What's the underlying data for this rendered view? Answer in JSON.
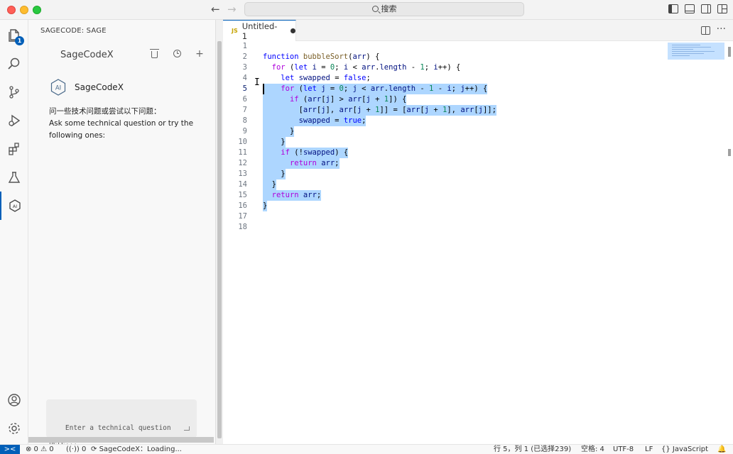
{
  "titlebar": {
    "search_label": "搜索"
  },
  "activity": {
    "explorer_badge": "1"
  },
  "sidebar": {
    "title": "SAGECODE: SAGE",
    "panel_name": "SageCodeX",
    "bot_name": "SageCodeX",
    "intro_cn": "问一些技术问题或尝试以下问题：",
    "intro_en": "Ask some technical question or try the following ones:",
    "input_placeholder": "Enter a technical question here..."
  },
  "editor": {
    "tab_lang_badge": "JS",
    "tab_name": "Untitled-1",
    "lines": [
      {
        "n": "1",
        "code": ""
      },
      {
        "n": "2",
        "code": "function bubbleSort(arr) {"
      },
      {
        "n": "3",
        "code": "  for (let i = 0; i < arr.length - 1; i++) {"
      },
      {
        "n": "4",
        "code": "    let swapped = false;"
      },
      {
        "n": "5",
        "code": "    for (let j = 0; j < arr.length - 1 - i; j++) {"
      },
      {
        "n": "6",
        "code": "      if (arr[j] > arr[j + 1]) {"
      },
      {
        "n": "7",
        "code": "        [arr[j], arr[j + 1]] = [arr[j + 1], arr[j]];"
      },
      {
        "n": "8",
        "code": "        swapped = true;"
      },
      {
        "n": "9",
        "code": "      }"
      },
      {
        "n": "10",
        "code": "    }"
      },
      {
        "n": "11",
        "code": "    if (!swapped) {"
      },
      {
        "n": "12",
        "code": "      return arr;"
      },
      {
        "n": "13",
        "code": "    }"
      },
      {
        "n": "14",
        "code": "  }"
      },
      {
        "n": "15",
        "code": "  return arr;"
      },
      {
        "n": "16",
        "code": "}"
      },
      {
        "n": "17",
        "code": ""
      },
      {
        "n": "18",
        "code": ""
      }
    ],
    "current_line": "5"
  },
  "statusbar": {
    "remote": "><",
    "problems": "⊗ 0 ⚠ 0",
    "ports": "0",
    "extension_status": "SageCodeX：Loading...",
    "position": "行 5，列 1 (已选择239)",
    "indent": "空格: 4",
    "encoding": "UTF-8",
    "eol": "LF",
    "language": "JavaScript"
  },
  "colors": {
    "accent": "#005fb8",
    "selection": "#add6ff",
    "keyword": "#0000ff",
    "control": "#af00db"
  }
}
